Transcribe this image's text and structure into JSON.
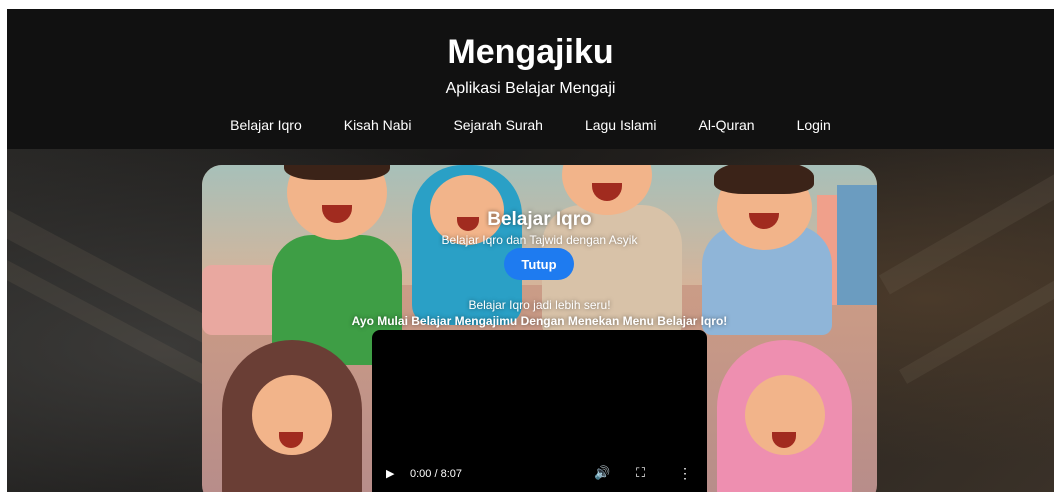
{
  "header": {
    "title": "Mengajiku",
    "subtitle": "Aplikasi Belajar Mengaji",
    "nav": [
      "Belajar Iqro",
      "Kisah Nabi",
      "Sejarah Surah",
      "Lagu Islami",
      "Al-Quran",
      "Login"
    ]
  },
  "hero": {
    "title": "Belajar Iqro",
    "subtitle": "Belajar Iqro dan Tajwid dengan Asyik",
    "close_label": "Tutup",
    "line1": "Belajar Iqro jadi lebih seru!",
    "line2": "Ayo Mulai Belajar Mengajimu Dengan Menekan Menu Belajar Iqro!"
  },
  "video": {
    "play_icon": "play-icon",
    "time": "0:00 / 8:07",
    "volume_icon": "volume-icon",
    "fullscreen_icon": "fullscreen-icon",
    "more_icon": "more-options-icon",
    "progress": 0
  },
  "colors": {
    "header_bg": "#111111",
    "button_blue": "#1e7bf0"
  }
}
